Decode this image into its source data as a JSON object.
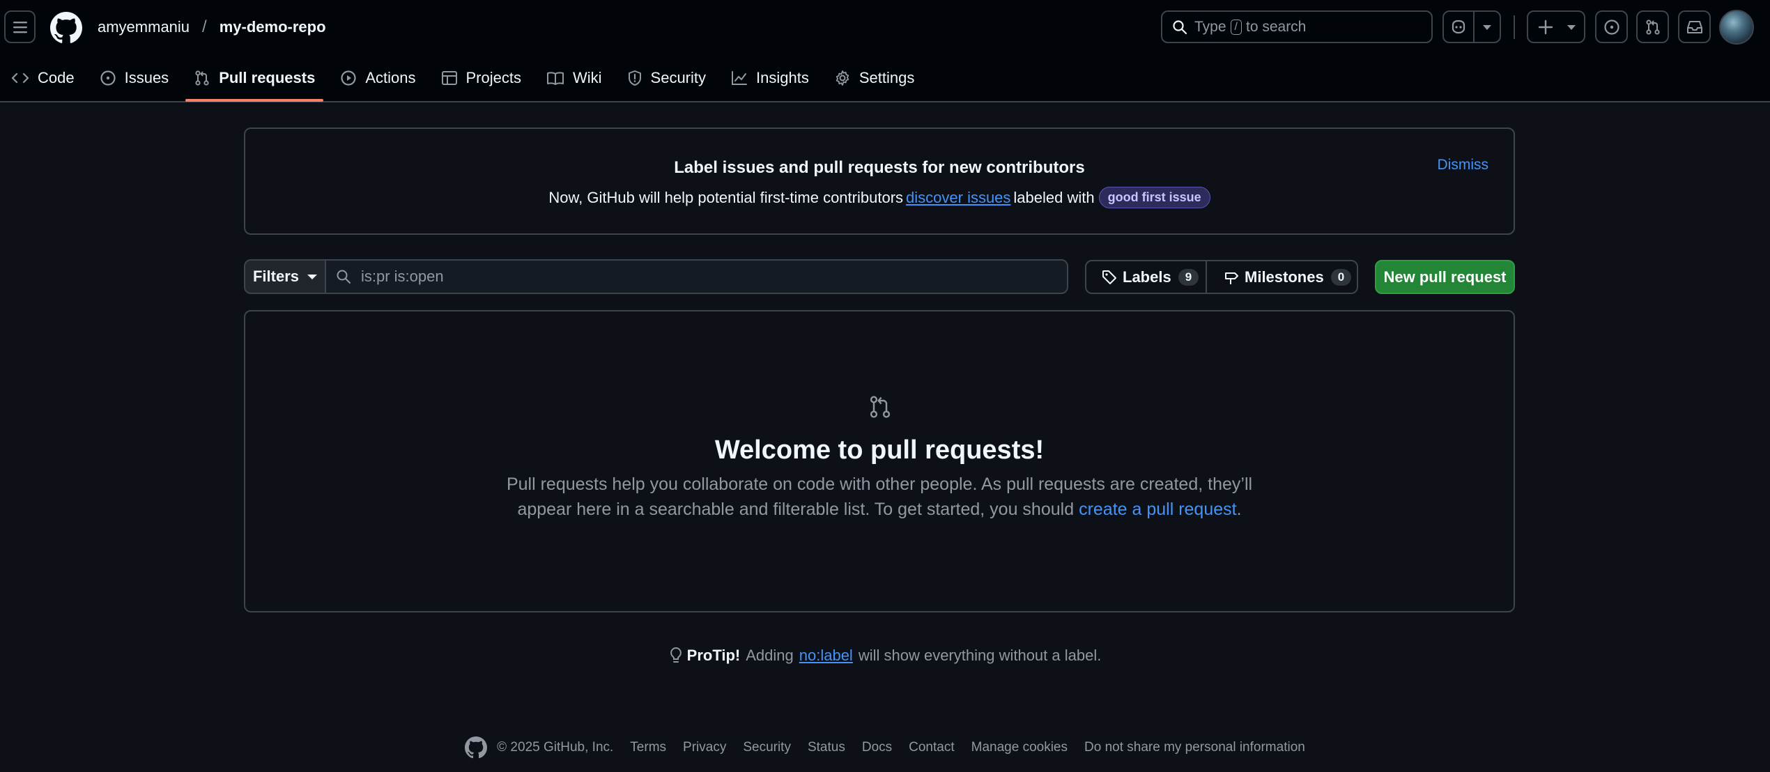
{
  "header": {
    "owner": "amyemmaniu",
    "separator": "/",
    "repo": "my-demo-repo",
    "search_prefix": "Type",
    "search_key": "/",
    "search_suffix": "to search",
    "icons": [
      "hamburger-icon",
      "github-logo-icon",
      "search-icon",
      "copilot-icon",
      "plus-icon",
      "issue-opened-icon",
      "git-pull-request-icon",
      "inbox-icon",
      "avatar"
    ]
  },
  "nav": {
    "tabs": [
      {
        "label": "Code",
        "icon": "code-icon"
      },
      {
        "label": "Issues",
        "icon": "issue-opened-icon"
      },
      {
        "label": "Pull requests",
        "icon": "git-pull-request-icon",
        "active": true
      },
      {
        "label": "Actions",
        "icon": "play-icon"
      },
      {
        "label": "Projects",
        "icon": "table-icon"
      },
      {
        "label": "Wiki",
        "icon": "book-icon"
      },
      {
        "label": "Security",
        "icon": "shield-icon"
      },
      {
        "label": "Insights",
        "icon": "graph-icon"
      },
      {
        "label": "Settings",
        "icon": "gear-icon"
      }
    ],
    "active_color": "#f78166"
  },
  "banner": {
    "title": "Label issues and pull requests for new contributors",
    "text_before": "Now, GitHub will help potential first-time contributors",
    "link": "discover issues",
    "text_after": "labeled with",
    "label": "good first issue",
    "dismiss": "Dismiss"
  },
  "toolbar": {
    "filters": "Filters",
    "search_placeholder": "is:pr is:open",
    "labels": "Labels",
    "labels_count": "9",
    "milestones": "Milestones",
    "milestones_count": "0",
    "new_pr": "New pull request",
    "new_pr_color": "#238636"
  },
  "blankslate": {
    "title": "Welcome to pull requests!",
    "line1": "Pull requests help you collaborate on code with other people. As pull requests are created, they’ll",
    "line2_before": "appear here in a searchable and filterable list. To get started, you should",
    "link": "create a pull request",
    "line2_after": "."
  },
  "protip": {
    "bold": "ProTip!",
    "before": "Adding",
    "link": "no:label",
    "after": "will show everything without a label."
  },
  "footer": {
    "copyright": "© 2025 GitHub, Inc.",
    "links": [
      "Terms",
      "Privacy",
      "Security",
      "Status",
      "Docs",
      "Contact",
      "Manage cookies",
      "Do not share my personal information"
    ]
  },
  "colors": {
    "background": "#0d1117",
    "header_bg": "#010409",
    "border": "#3d444d",
    "link": "#4493f8"
  }
}
